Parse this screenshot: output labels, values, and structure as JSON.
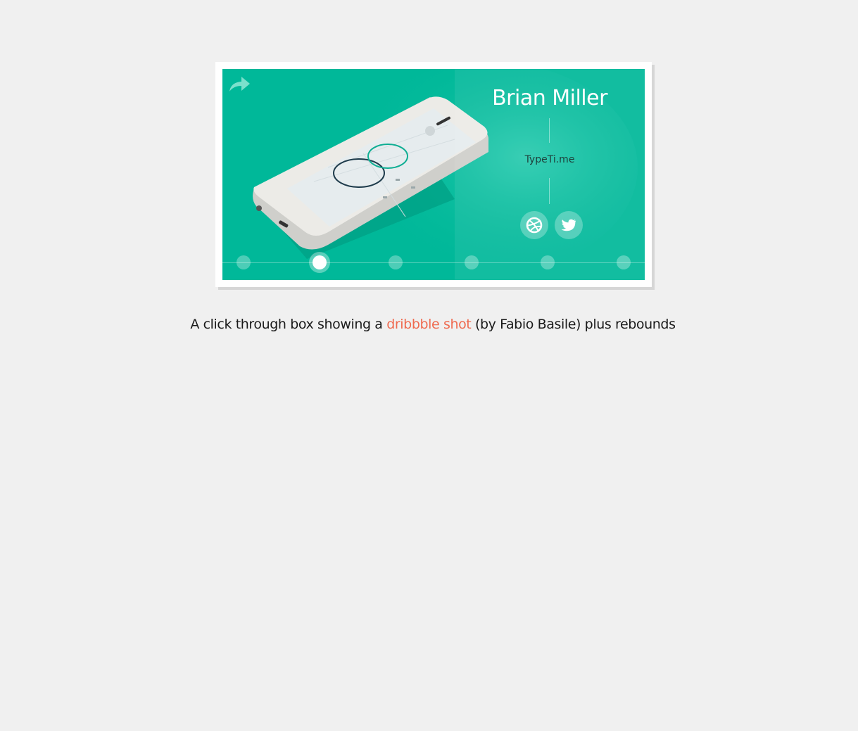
{
  "card": {
    "player_name": "Brian Miller",
    "shot_title": "TypeTi.me",
    "share_icon": "share-arrow-icon",
    "social": [
      {
        "name": "dribbble",
        "icon": "dribbble-icon"
      },
      {
        "name": "twitter",
        "icon": "twitter-icon"
      }
    ],
    "timeline": {
      "count": 6,
      "active_index": 1
    },
    "colors": {
      "accent": "#00b899",
      "panel_text": "#ffffff"
    }
  },
  "caption": {
    "prefix": "A click through box showing a ",
    "link_text": "dribbble shot",
    "suffix": " (by Fabio Basile) plus rebounds",
    "link_color": "#ef6a4f"
  }
}
